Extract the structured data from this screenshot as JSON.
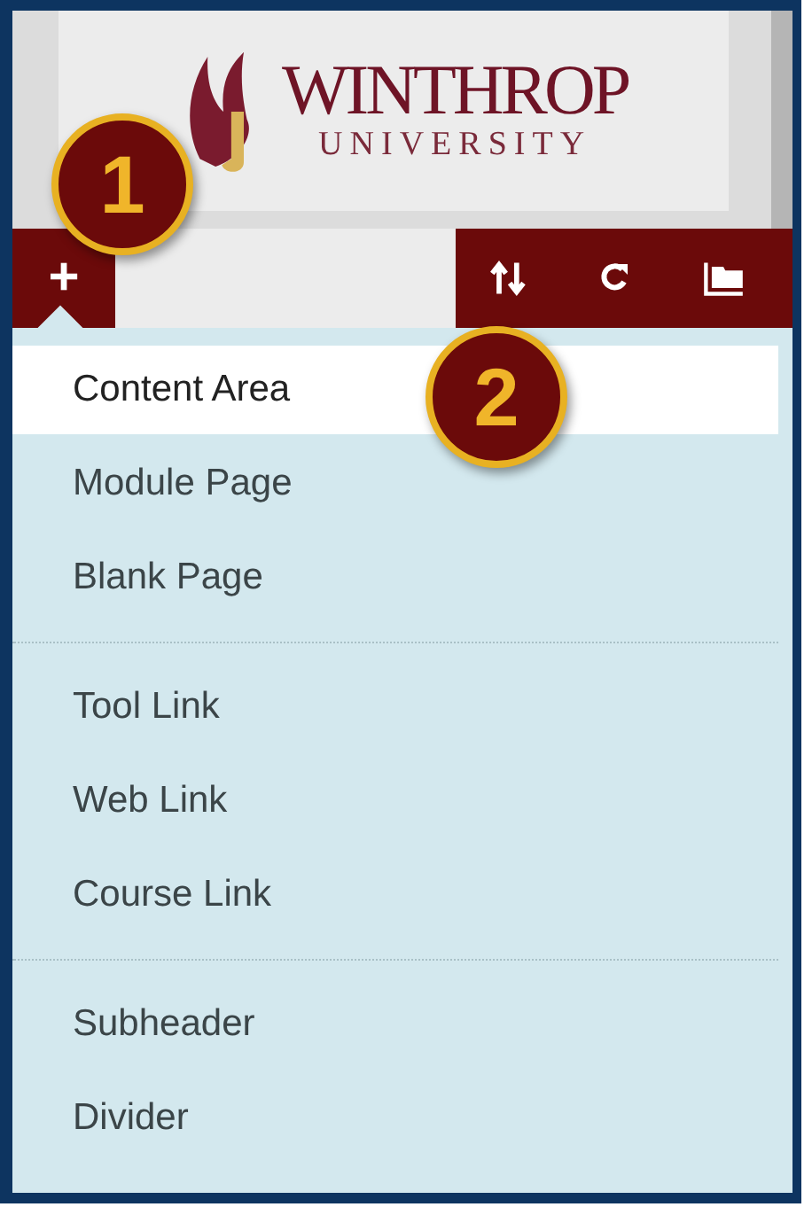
{
  "logo": {
    "title": "WINTHROP",
    "subtitle": "UNIVERSITY"
  },
  "toolbar": {
    "add_button": "+"
  },
  "callouts": [
    "1",
    "2"
  ],
  "menu": {
    "groups": [
      {
        "items": [
          {
            "label": "Content Area",
            "selected": true
          },
          {
            "label": "Module Page",
            "selected": false
          },
          {
            "label": "Blank Page",
            "selected": false
          }
        ]
      },
      {
        "items": [
          {
            "label": "Tool Link",
            "selected": false
          },
          {
            "label": "Web Link",
            "selected": false
          },
          {
            "label": "Course Link",
            "selected": false
          }
        ]
      },
      {
        "items": [
          {
            "label": "Subheader",
            "selected": false
          },
          {
            "label": "Divider",
            "selected": false
          }
        ]
      }
    ]
  }
}
